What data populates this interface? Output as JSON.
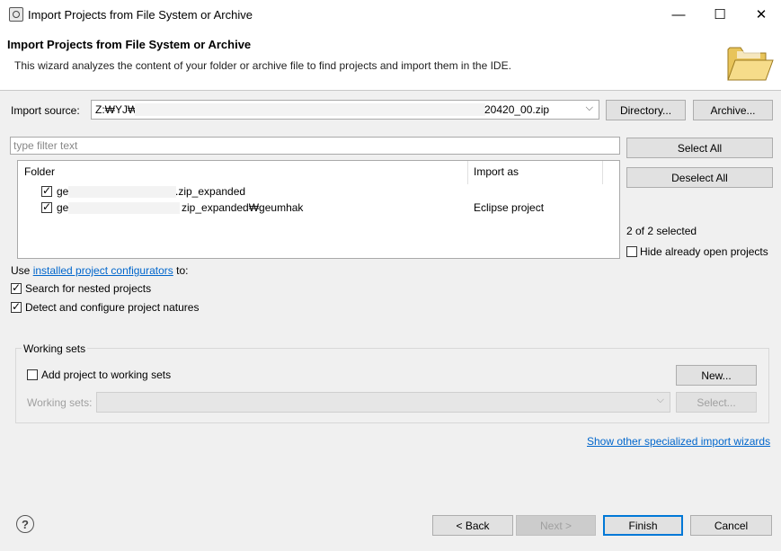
{
  "window": {
    "title": "Import Projects from File System or Archive",
    "controls": {
      "minimize": "—",
      "maximize": "☐",
      "close": "✕"
    }
  },
  "header": {
    "title": "Import Projects from File System or Archive",
    "description": "This wizard analyzes the content of your folder or archive file to find projects and import them in the IDE."
  },
  "import_source": {
    "label": "Import source:",
    "value_start": "Z:₩YJ₩",
    "value_end": "20420_00.zip",
    "directory_button": "Directory...",
    "archive_button": "Archive..."
  },
  "filter": {
    "placeholder": "type filter text"
  },
  "table": {
    "headers": {
      "folder": "Folder",
      "import_as": "Import as"
    },
    "rows": [
      {
        "folder_start": "ge",
        "folder_end": ".zip_expanded",
        "import_as": "",
        "checked": true
      },
      {
        "folder_start": "ge",
        "folder_end": "zip_expanded₩geumhak",
        "import_as": "Eclipse project",
        "checked": true
      }
    ]
  },
  "side": {
    "select_all": "Select All",
    "deselect_all": "Deselect All",
    "selection_status": "2 of 2 selected",
    "hide_open_label": "Hide already open projects"
  },
  "configurators": {
    "prefix": "Use ",
    "link": "installed project configurators",
    "suffix": " to:"
  },
  "options": {
    "nested": "Search for nested projects",
    "natures": "Detect and configure project natures"
  },
  "working_sets": {
    "group_label": "Working sets",
    "add_label": "Add project to working sets",
    "new_button": "New...",
    "sets_label": "Working sets:",
    "select_button": "Select..."
  },
  "wizards_link": "Show other specialized import wizards",
  "footer": {
    "help": "?",
    "back": "< Back",
    "next": "Next >",
    "finish": "Finish",
    "cancel": "Cancel"
  }
}
